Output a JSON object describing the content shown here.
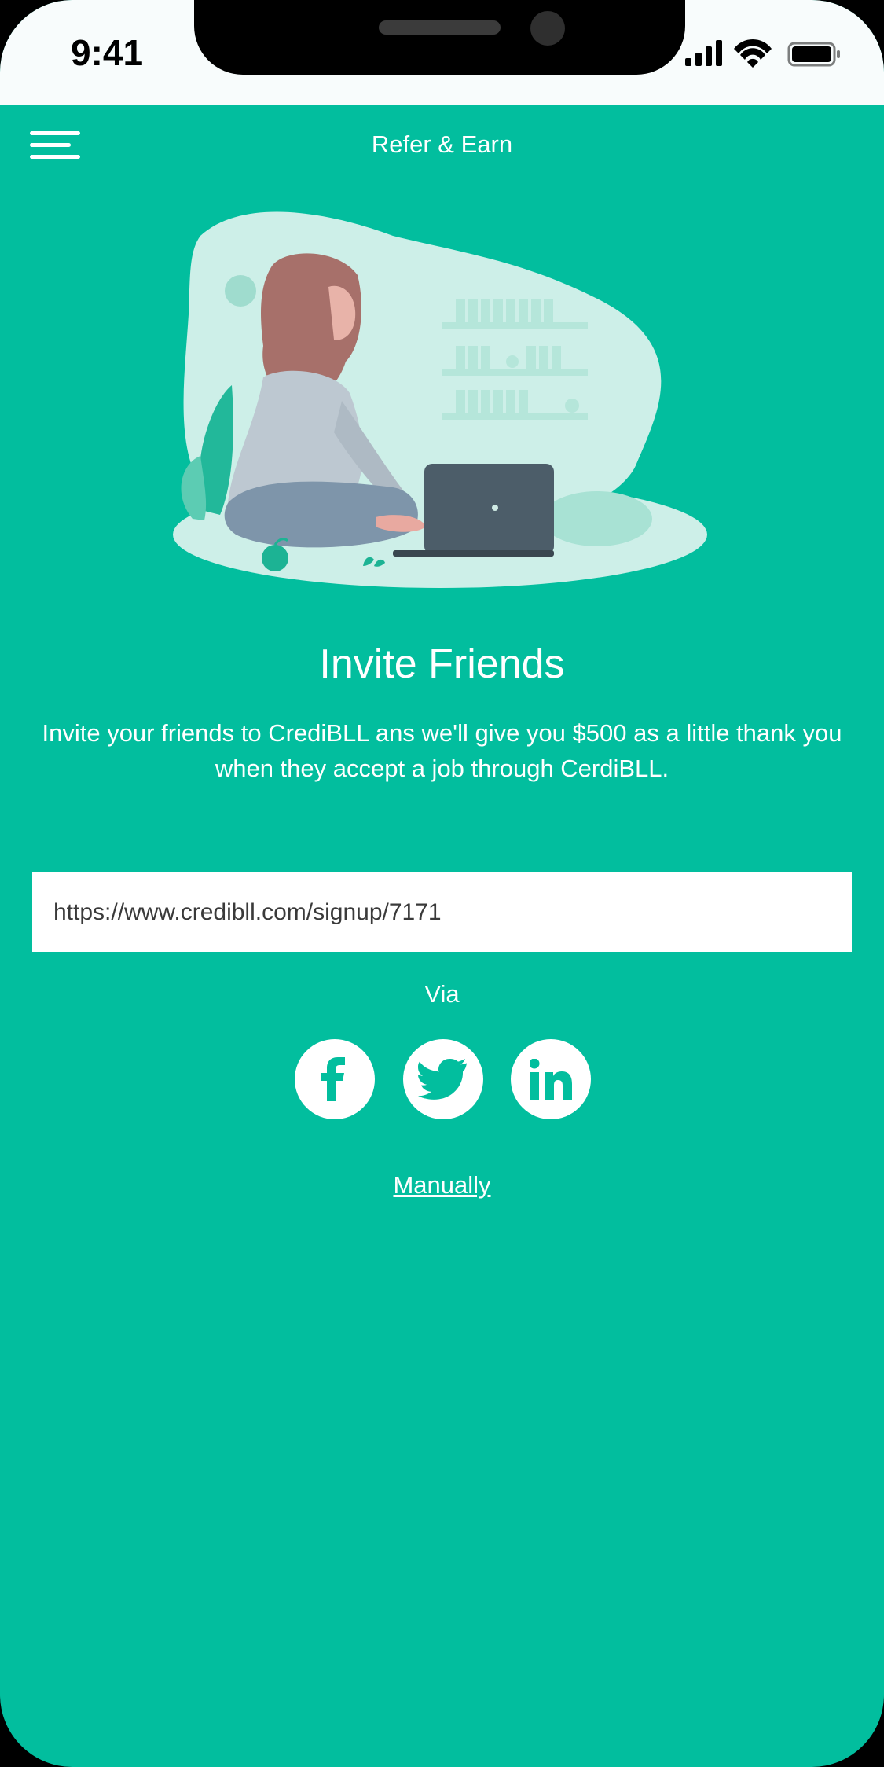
{
  "status_bar": {
    "time": "9:41",
    "signal_icon": "cellular-signal-icon",
    "wifi_icon": "wifi-icon",
    "battery_icon": "battery-icon"
  },
  "header": {
    "menu_icon": "hamburger-menu-icon",
    "title": "Refer & Earn"
  },
  "main": {
    "heading": "Invite Friends",
    "description": "Invite your friends to CrediBLL ans we'll give you $500 as a little thank you when they accept a job through CerdiBLL.",
    "referral_link": "https://www.credibll.com/signup/7171",
    "via_label": "Via",
    "share_buttons": [
      {
        "name": "facebook",
        "icon": "facebook-icon"
      },
      {
        "name": "twitter",
        "icon": "twitter-icon"
      },
      {
        "name": "linkedin",
        "icon": "linkedin-icon"
      }
    ],
    "manual_link": "Manually"
  },
  "colors": {
    "background": "#02BE9E",
    "text": "#FFFFFF",
    "input_bg": "#FFFFFF"
  }
}
